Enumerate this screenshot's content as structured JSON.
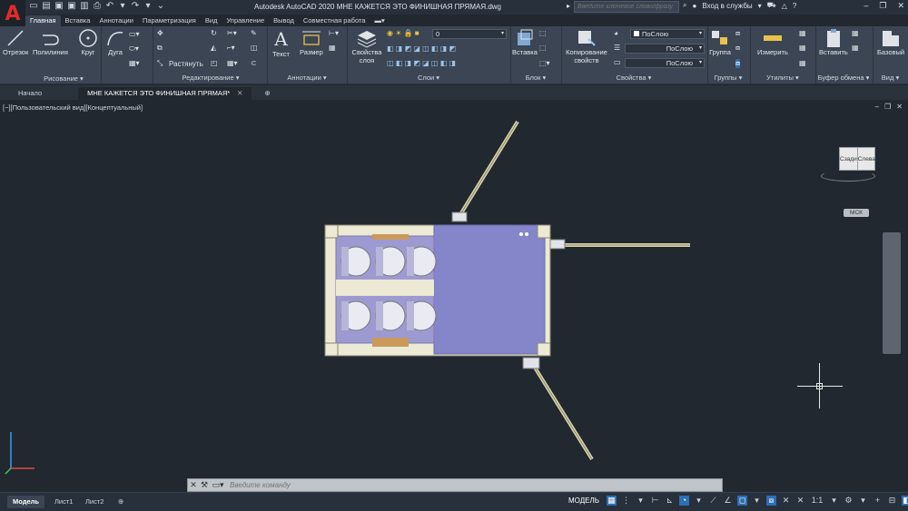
{
  "app": {
    "title": "Autodesk AutoCAD 2020    МНЕ КАЖЕТСЯ ЭТО ФИНИШНАЯ ПРЯМАЯ.dwg",
    "search_placeholder": "Введите ключевое слово/фразу",
    "signin": "Вход в службы",
    "logo": "A"
  },
  "ribbon_tabs": [
    "Главная",
    "Вставка",
    "Аннотации",
    "Параметризация",
    "Вид",
    "Управление",
    "Вывод",
    "Совместная работа"
  ],
  "panels": {
    "draw": {
      "title": "Рисование",
      "tools": [
        "Отрезок",
        "Полилиния",
        "Круг",
        "Дуга"
      ]
    },
    "modify": {
      "title": "Редактирование",
      "stretch": "Растянуть"
    },
    "annotation": {
      "title": "Аннотации",
      "text": "Текст",
      "dimension": "Размер"
    },
    "layers": {
      "title": "Слои",
      "props": "Свойства слоя",
      "layer_value": "0"
    },
    "block": {
      "title": "Блок",
      "insert": "Вставка"
    },
    "properties": {
      "title": "Свойства",
      "match": "Копирование свойств",
      "color": "ПоСлою",
      "linetype": "ПоСлою",
      "lineweight": "ПоСлою"
    },
    "groups": {
      "title": "Группы",
      "group": "Группа"
    },
    "utilities": {
      "title": "Утилиты",
      "measure": "Измерить"
    },
    "clipboard": {
      "title": "Буфер обмена",
      "paste": "Вставить"
    },
    "view": {
      "title": "Вид",
      "base": "Базовый"
    }
  },
  "doc_tabs": {
    "start": "Начало",
    "active": "МНЕ КАЖЕТСЯ ЭТО ФИНИШНАЯ ПРЯМАЯ*"
  },
  "viewport": {
    "label": "[−][Пользовательский вид][Концептуальный]",
    "cube_left": "Сзади",
    "cube_right": "Слева",
    "wcs": "МСК"
  },
  "command": {
    "placeholder": "Введите команду"
  },
  "status": {
    "layouts": [
      "Модель",
      "Лист1",
      "Лист2"
    ],
    "model": "МОДЕЛЬ",
    "scale": "1:1"
  },
  "colors": {
    "accent": "#2d6fb2",
    "satellite_body": "#8585c9",
    "frame": "#ece9d4"
  }
}
